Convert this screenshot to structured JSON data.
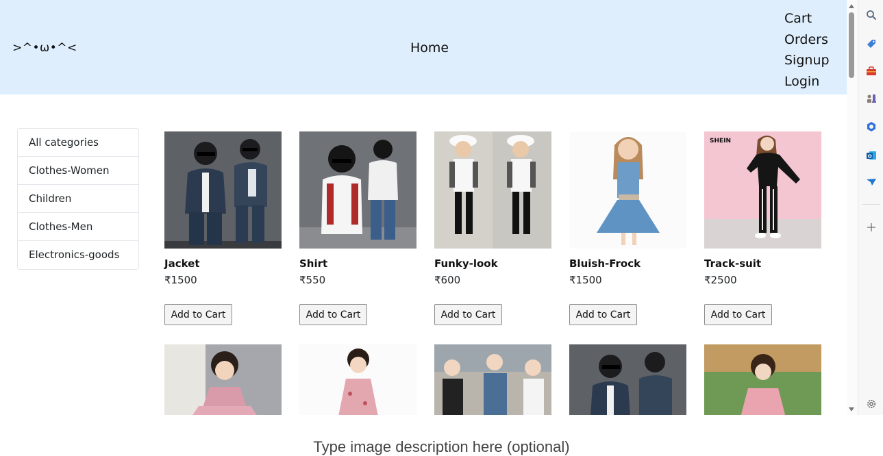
{
  "navbar": {
    "brand": ">^•ω•^<",
    "home": "Home",
    "links": [
      "Cart",
      "Orders",
      "Signup",
      "Login"
    ]
  },
  "categories": [
    "All categories",
    "Clothes-Women",
    "Children",
    "Clothes-Men",
    "Electronics-goods"
  ],
  "products": [
    {
      "name": "Jacket",
      "price": "₹1500",
      "button": "Add to Cart"
    },
    {
      "name": "Shirt",
      "price": "₹550",
      "button": "Add to Cart"
    },
    {
      "name": "Funky-look",
      "price": "₹600",
      "button": "Add to Cart"
    },
    {
      "name": "Bluish-Frock",
      "price": "₹1500",
      "button": "Add to Cart"
    },
    {
      "name": "Track-suit",
      "price": "₹2500",
      "button": "Add to Cart"
    }
  ],
  "sidebar_icons": [
    "search-icon",
    "tag-icon",
    "briefcase-icon",
    "chess-icon",
    "copilot-icon",
    "outlook-icon",
    "send-icon",
    "add-icon",
    "settings-icon"
  ],
  "caption": "Type image description here (optional)",
  "colors": {
    "navbar_bg": "#deeefc"
  }
}
